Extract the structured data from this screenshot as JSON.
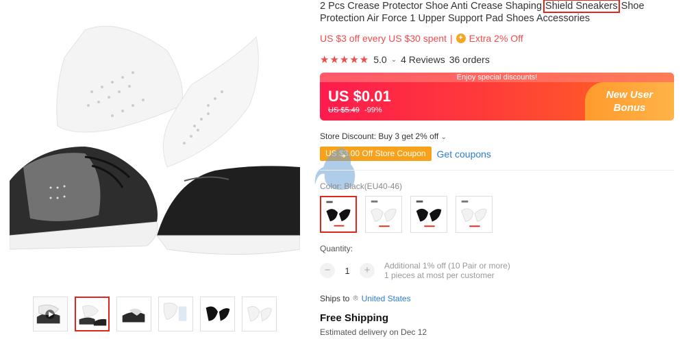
{
  "product": {
    "title_part1": "2 Pcs Crease Protector Shoe Anti Crease Shaping ",
    "title_highlight": "Shield Sneakers",
    "title_part2": " Shoe Protection Air Force 1 Upper Support Pad Shoes Accessories"
  },
  "promo": {
    "offer": "US $3 off every US $30 spent",
    "separator": "|",
    "extra": "Extra 2% Off"
  },
  "rating": {
    "stars": "★★★★★",
    "score": "5.0",
    "reviews": "4 Reviews",
    "orders": "36 orders"
  },
  "price_banner": {
    "strip": "Enjoy special discounts!",
    "price": "US $0.01",
    "original": "US $5.49",
    "discount": "-99%",
    "bonus_line1": "New User",
    "bonus_line2": "Bonus"
  },
  "store": {
    "discount": "Store Discount: Buy 3 get 2% off",
    "coupon": "US $3.00 Off Store Coupon",
    "get_coupons": "Get coupons"
  },
  "variant": {
    "color_label": "Color: Black(EU40-46)",
    "swatches": [
      {
        "shade": "black",
        "selected": true
      },
      {
        "shade": "white",
        "selected": false
      },
      {
        "shade": "black",
        "selected": false
      },
      {
        "shade": "white",
        "selected": false
      }
    ]
  },
  "quantity": {
    "label": "Quantity:",
    "minus": "−",
    "value": "1",
    "plus": "+",
    "note1": "Additional 1% off (10 Pair or more)",
    "note2": "1 pieces at most per customer"
  },
  "shipping": {
    "ships_to": "Ships to",
    "country": "United States",
    "free": "Free Shipping",
    "estimate": "Estimated delivery on Dec 12"
  },
  "colors": {
    "accent": "#e1251b",
    "promo": "#f14b4b",
    "link": "#2d7dd2",
    "coupon": "#f8a21b"
  }
}
